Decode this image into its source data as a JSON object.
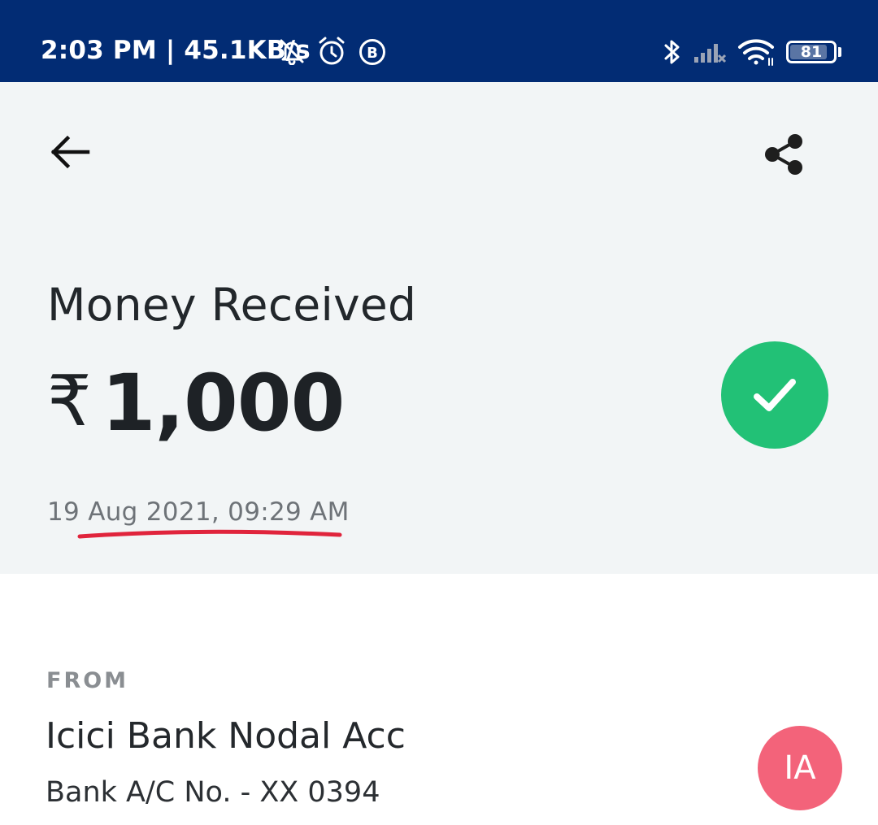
{
  "status_bar": {
    "time_and_speed": "2:03 PM | 45.1KB/s",
    "battery_level": "81",
    "icons": [
      "notifications-off-icon",
      "alarm-icon",
      "b-badge-icon",
      "bluetooth-icon",
      "signal-icon",
      "wifi-icon",
      "battery-icon"
    ]
  },
  "header": {
    "title": "Money Received",
    "currency_symbol": "₹",
    "amount": "1,000",
    "timestamp": "19 Aug 2021, 09:29 AM",
    "status": "success",
    "colors": {
      "status_bar_bg": "#022c74",
      "header_bg": "#f2f5f6",
      "success": "#22c176",
      "highlight_underline": "#e0243c"
    }
  },
  "from": {
    "label": "FROM",
    "name": "Icici Bank Nodal Acc",
    "account": "Bank A/C No. - XX 0394",
    "avatar_initials": "IA",
    "avatar_color": "#f3637a"
  }
}
